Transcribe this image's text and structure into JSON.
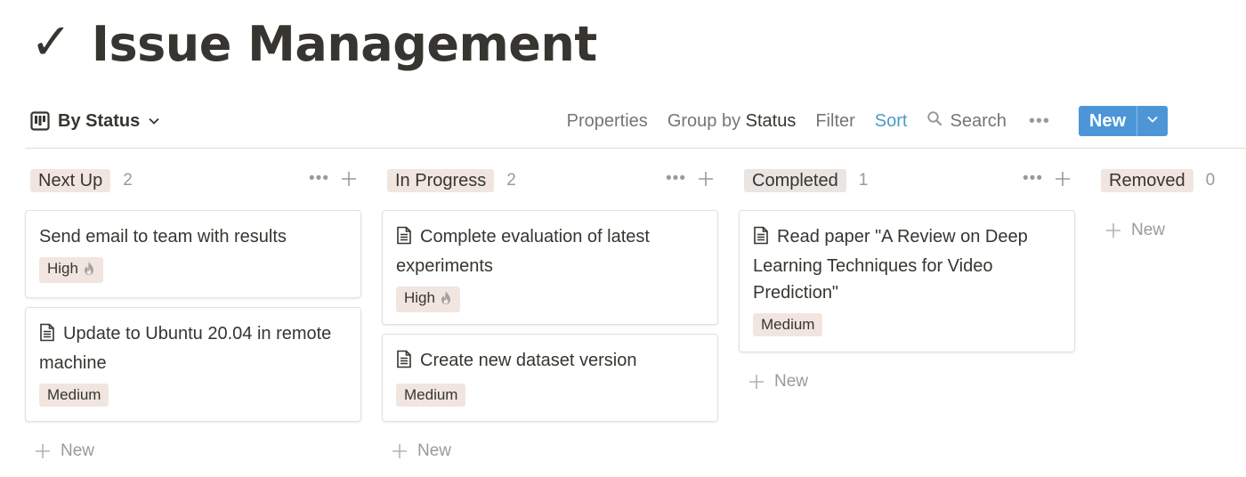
{
  "page": {
    "icon": "check-icon",
    "icon_glyph": "✓",
    "title": "Issue Management"
  },
  "toolbar": {
    "view_icon": "board-view-icon",
    "view_label": "By Status",
    "properties_label": "Properties",
    "group_by_prefix": "Group by",
    "group_by_value": "Status",
    "filter_label": "Filter",
    "sort_label": "Sort",
    "search_label": "Search",
    "more_label": "•••",
    "new_label": "New",
    "colors": {
      "new_button_bg": "#4c96d8",
      "sort_active": "#4f9ac7"
    }
  },
  "board": {
    "columns": [
      {
        "label": "Next Up",
        "count": "2",
        "color": "#f1e6df",
        "add_label": "New",
        "cards": [
          {
            "title": "Send email to team with results",
            "has_icon": false,
            "tag": "High",
            "tag_icon": "fire-icon"
          },
          {
            "title": "Update to Ubuntu 20.04 in remote machine",
            "has_icon": true,
            "tag": "Medium",
            "tag_icon": ""
          }
        ]
      },
      {
        "label": "In Progress",
        "count": "2",
        "color": "#f1e6df",
        "add_label": "New",
        "cards": [
          {
            "title": "Complete evaluation of latest experiments",
            "has_icon": true,
            "tag": "High",
            "tag_icon": "fire-icon"
          },
          {
            "title": "Create new dataset version",
            "has_icon": true,
            "tag": "Medium",
            "tag_icon": ""
          }
        ]
      },
      {
        "label": "Completed",
        "count": "1",
        "color": "#e9e5e3",
        "add_label": "New",
        "cards": [
          {
            "title": "Read paper \"A Review on Deep Learning Techniques for Video Prediction\"",
            "has_icon": true,
            "tag": "Medium",
            "tag_icon": ""
          }
        ]
      },
      {
        "label": "Removed",
        "count": "0",
        "color": "#f1e6df",
        "add_label": "New",
        "cards": []
      }
    ]
  },
  "colors": {
    "tag_bg": "#f1e6df",
    "text": "#37352f",
    "muted": "#9b9a97"
  }
}
